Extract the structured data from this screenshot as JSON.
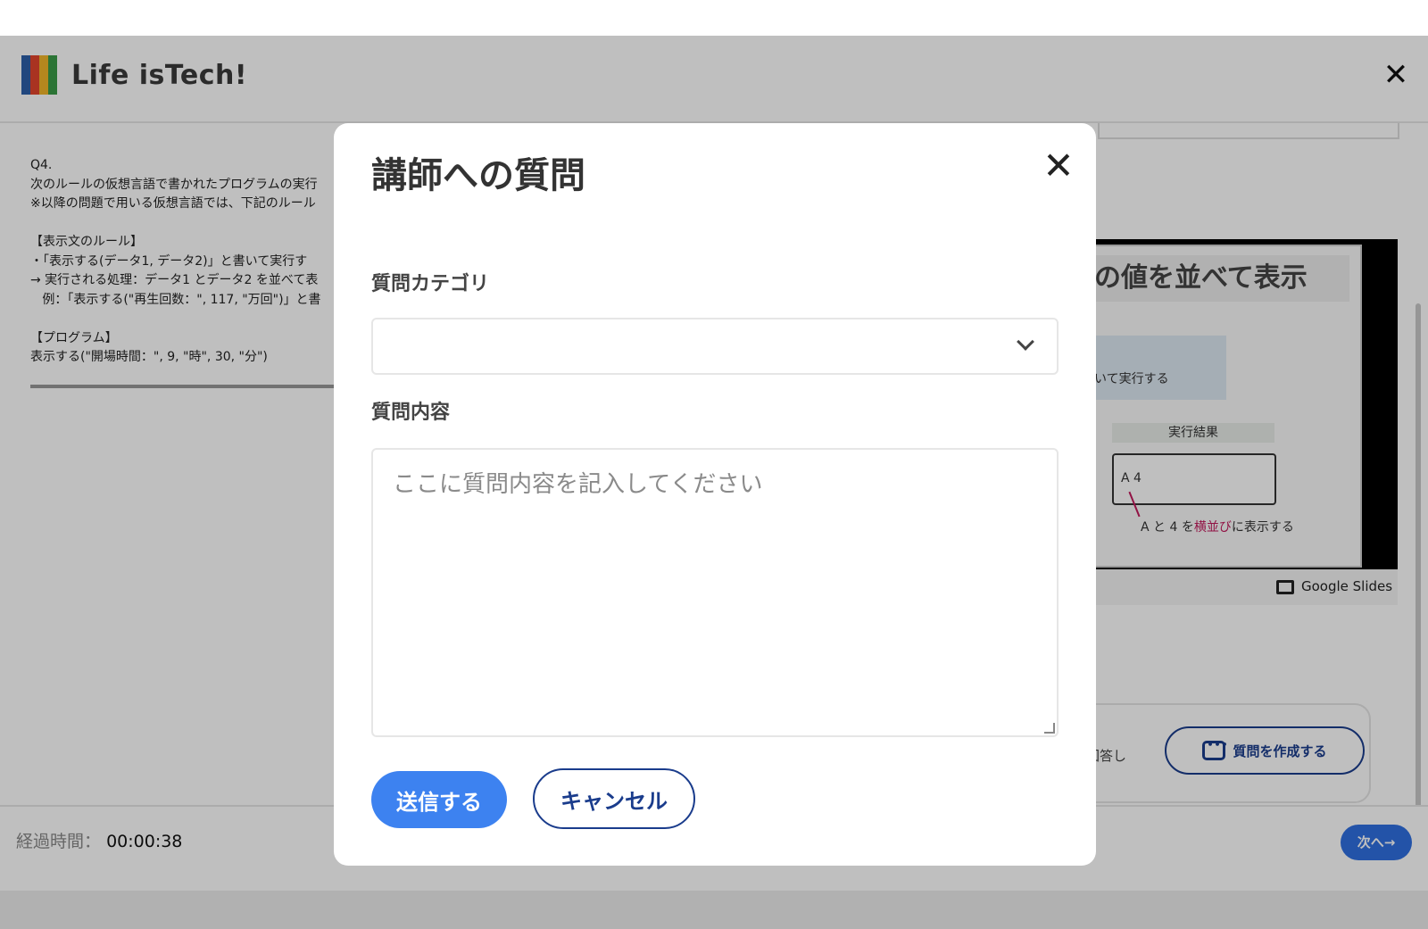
{
  "brand": {
    "name": "Life isTech!",
    "logo_colors": [
      "#2d5fa8",
      "#e2452c",
      "#f0b429",
      "#3a9b47"
    ]
  },
  "header": {
    "close_icon": "close-icon"
  },
  "question": {
    "text": "Q4.\n次のルールの仮想言語で書かれたプログラムの実行\n※以降の問題で用いる仮想言語では、下記のルール\n\n【表示文のルール】\n・「表示する(データ1, データ2)」と書いて実行す\n→ 実行される処理：データ1 とデータ2 を並べて表\n   例：「表示する(\"再生回数：\", 117, \"万回\")」と書\n\n【プログラム】\n表示する(\"開場時間：\", 9, \"時\", 30, \"分\")"
  },
  "slide": {
    "title": "の値を並べて表示",
    "blue_text": "いて実行する",
    "result_label": "実行結果",
    "result_value": "A 4",
    "note_pre": "A と 4 を",
    "note_em": "横並び",
    "note_post": "に表示する",
    "footer_label": "Google Slides"
  },
  "qa": {
    "text": "に回答し",
    "button_label": "質問を作成する"
  },
  "footer": {
    "elapsed_label": "経過時間：",
    "elapsed_value": "00:00:38",
    "next_label": "次へ→"
  },
  "modal": {
    "title": "講師への質問",
    "category_label": "質問カテゴリ",
    "category_value": "",
    "content_label": "質問内容",
    "content_placeholder": "ここに質問内容を記入してください",
    "content_value": "",
    "submit_label": "送信する",
    "cancel_label": "キャンセル"
  },
  "colors": {
    "primary": "#3d82f0",
    "navy": "#1a3c8c",
    "accent_pink": "#c2185b"
  }
}
